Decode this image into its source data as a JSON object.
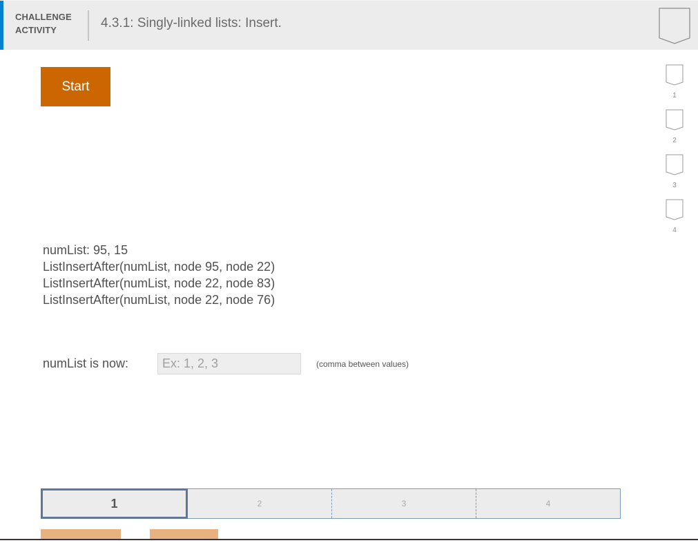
{
  "header": {
    "activity_type_line1": "CHALLENGE",
    "activity_type_line2": "ACTIVITY",
    "title": "4.3.1: Singly-linked lists: Insert.",
    "completion_badge_icon": "badge-outline-icon",
    "accent_color": "#0581d1"
  },
  "start_button": {
    "label": "Start",
    "color": "#cc6600"
  },
  "levels": [
    {
      "label": "1",
      "icon": "badge-outline-icon",
      "completed": false
    },
    {
      "label": "2",
      "icon": "badge-outline-icon",
      "completed": false
    },
    {
      "label": "3",
      "icon": "badge-outline-icon",
      "completed": false
    },
    {
      "label": "4",
      "icon": "badge-outline-icon",
      "completed": false
    }
  ],
  "problem": {
    "lines": [
      "numList: 95, 15",
      "ListInsertAfter(numList, node 95, node 22)",
      "ListInsertAfter(numList, node 22, node 83)",
      "ListInsertAfter(numList, node 22, node 76)"
    ]
  },
  "answer": {
    "label": "numList is now:",
    "value": "",
    "placeholder": "Ex: 1, 2, 3",
    "hint": "(comma between values)"
  },
  "progress": {
    "current": 1,
    "segments": [
      "1",
      "2",
      "3",
      "4"
    ]
  },
  "bottom_buttons": [
    {
      "label": "",
      "name": "check-button"
    },
    {
      "label": "",
      "name": "next-button"
    }
  ]
}
